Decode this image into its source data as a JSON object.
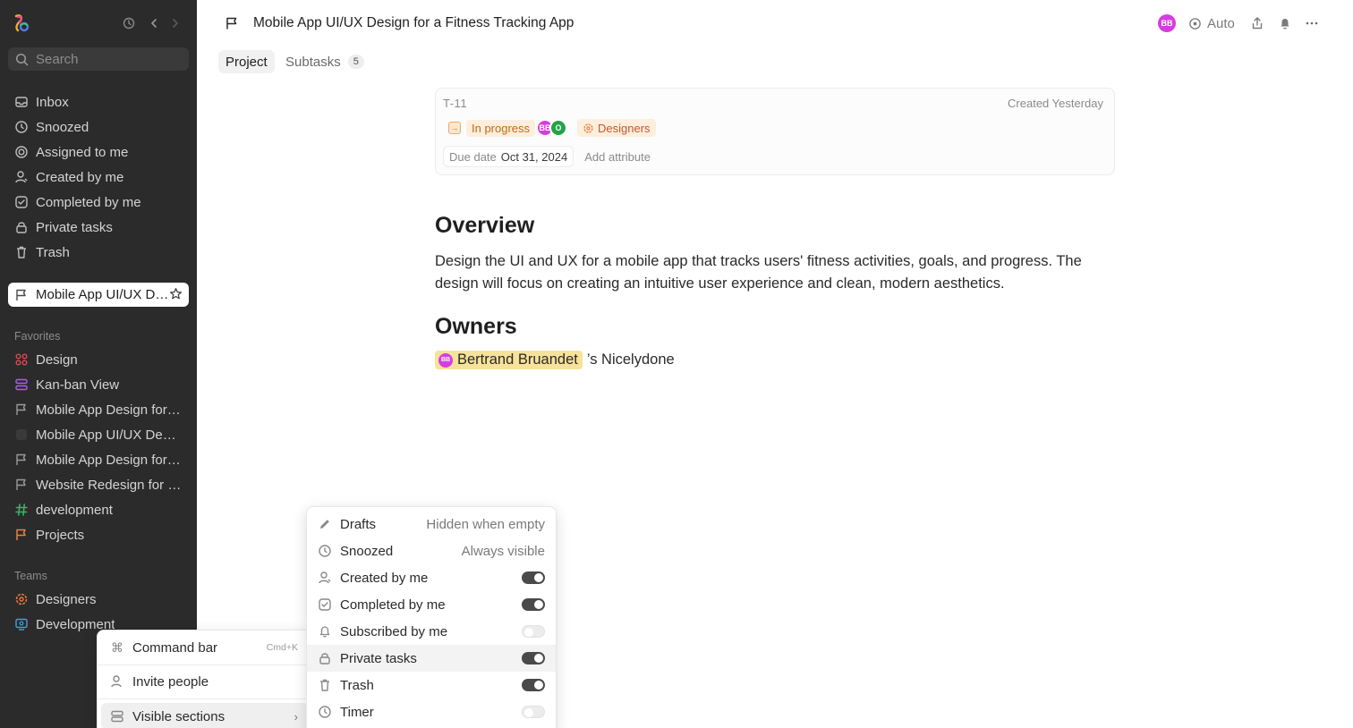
{
  "sidebar": {
    "search_placeholder": "Search",
    "nav": [
      {
        "label": "Inbox",
        "icon": "inbox-icon"
      },
      {
        "label": "Snoozed",
        "icon": "clock-icon"
      },
      {
        "label": "Assigned to me",
        "icon": "target-icon"
      },
      {
        "label": "Created by me",
        "icon": "user-icon"
      },
      {
        "label": "Completed by me",
        "icon": "check-square-icon"
      },
      {
        "label": "Private tasks",
        "icon": "lock-icon"
      },
      {
        "label": "Trash",
        "icon": "trash-icon"
      }
    ],
    "active_item": {
      "label": "Mobile App UI/UX D…",
      "icon": "flag-icon"
    },
    "favorites_title": "Favorites",
    "favorites": [
      {
        "label": "Design",
        "icon": "grid-icon",
        "color": "#e5484d"
      },
      {
        "label": "Kan-ban View",
        "icon": "stack-icon",
        "color": "#b05ce6"
      },
      {
        "label": "Mobile App Design for …",
        "icon": "flag-icon",
        "color": "#9a9a9a"
      },
      {
        "label": "Mobile App UI/UX Desi…",
        "icon": "square-icon",
        "color": "#3a3a3a"
      },
      {
        "label": "Mobile App Design for …",
        "icon": "flag-icon",
        "color": "#9a9a9a"
      },
      {
        "label": "Website Redesign for a…",
        "icon": "flag-icon",
        "color": "#9a9a9a"
      },
      {
        "label": "development",
        "icon": "hash-icon",
        "color": "#38b26a"
      },
      {
        "label": "Projects",
        "icon": "flag-icon",
        "color": "#e8833a"
      }
    ],
    "teams_title": "Teams",
    "teams": [
      {
        "label": "Designers",
        "icon": "gear-icon",
        "color": "#ef7a3d"
      },
      {
        "label": "Development",
        "icon": "monitor-icon",
        "color": "#3aa3d8"
      }
    ]
  },
  "header": {
    "title": "Mobile App UI/UX Design for a Fitness Tracking App",
    "avatar_initials": "BB",
    "auto_label": "Auto"
  },
  "tabs": [
    {
      "label": "Project"
    },
    {
      "label": "Subtasks",
      "count": "5"
    }
  ],
  "task": {
    "id": "T-11",
    "created": "Created Yesterday",
    "status": "In progress",
    "assignees": [
      "BB",
      "O"
    ],
    "team": "Designers",
    "due_label": "Due date",
    "due_value": "Oct 31, 2024",
    "add_attribute": "Add attribute"
  },
  "doc": {
    "overview_heading": "Overview",
    "overview_text": "Design the UI and UX for a mobile app that tracks users' fitness activities, goals, and progress. The design will focus on creating an intuitive user experience and clean, modern aesthetics.",
    "owners_heading": "Owners",
    "owner_initials": "BB",
    "owner_name": "Bertrand Bruandet",
    "owner_suffix": "’s Nicelydone"
  },
  "menu_main": [
    {
      "label": "Command bar",
      "shortcut": "Cmd+K"
    },
    {
      "label": "Invite people"
    },
    {
      "label": "Visible sections"
    }
  ],
  "menu_sections": [
    {
      "label": "Drafts",
      "value": "Hidden when empty",
      "icon": "pencil-icon"
    },
    {
      "label": "Snoozed",
      "value": "Always visible",
      "icon": "clock-icon"
    },
    {
      "label": "Created by me",
      "toggle": true,
      "icon": "user-icon"
    },
    {
      "label": "Completed by me",
      "toggle": true,
      "icon": "check-square-icon"
    },
    {
      "label": "Subscribed by me",
      "toggle": false,
      "icon": "bell-icon"
    },
    {
      "label": "Private tasks",
      "toggle": true,
      "icon": "lock-icon"
    },
    {
      "label": "Trash",
      "toggle": true,
      "icon": "trash-icon"
    },
    {
      "label": "Timer",
      "toggle": false,
      "icon": "clock-icon"
    }
  ]
}
